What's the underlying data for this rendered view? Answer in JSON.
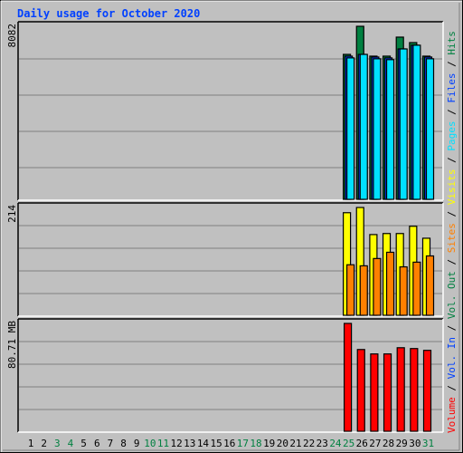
{
  "chart_data": {
    "type": "bar",
    "title": "Daily usage for October 2020",
    "categories": [
      "1",
      "2",
      "3",
      "4",
      "5",
      "6",
      "7",
      "8",
      "9",
      "10",
      "11",
      "12",
      "13",
      "14",
      "15",
      "16",
      "17",
      "18",
      "19",
      "20",
      "21",
      "22",
      "23",
      "24",
      "25",
      "26",
      "27",
      "28",
      "29",
      "30",
      "31"
    ],
    "weekend_days": [
      "3",
      "4",
      "10",
      "11",
      "17",
      "18",
      "24",
      "25",
      "31"
    ],
    "panels": [
      {
        "name": "hits-files-pages",
        "ymax_label": "8082",
        "ylim": [
          0,
          8082
        ],
        "series": [
          {
            "name": "Hits",
            "color": "#008040",
            "values": [
              null,
              null,
              null,
              null,
              null,
              null,
              null,
              null,
              null,
              null,
              null,
              null,
              null,
              null,
              null,
              null,
              null,
              null,
              null,
              null,
              null,
              null,
              null,
              null,
              6630,
              7915,
              6550,
              6550,
              7420,
              7170,
              6550
            ]
          },
          {
            "name": "Files",
            "color": "#0040FF",
            "values": [
              null,
              null,
              null,
              null,
              null,
              null,
              null,
              null,
              null,
              null,
              null,
              null,
              null,
              null,
              null,
              null,
              null,
              null,
              null,
              null,
              null,
              null,
              null,
              null,
              6550,
              6630,
              6510,
              6470,
              6880,
              7050,
              6510
            ]
          },
          {
            "name": "Pages",
            "color": "#00E0FF",
            "values": [
              null,
              null,
              null,
              null,
              null,
              null,
              null,
              null,
              null,
              null,
              null,
              null,
              null,
              null,
              null,
              null,
              null,
              null,
              null,
              null,
              null,
              null,
              null,
              null,
              6470,
              6630,
              6430,
              6390,
              6880,
              7050,
              6430
            ]
          }
        ]
      },
      {
        "name": "visits-sites",
        "ymax_label": "214",
        "ylim": [
          0,
          214
        ],
        "series": [
          {
            "name": "Visits",
            "color": "#FFFF00",
            "values": [
              null,
              null,
              null,
              null,
              null,
              null,
              null,
              null,
              null,
              null,
              null,
              null,
              null,
              null,
              null,
              null,
              null,
              null,
              null,
              null,
              null,
              null,
              null,
              null,
              197,
              207,
              155,
              157,
              157,
              171,
              148
            ]
          },
          {
            "name": "Sites",
            "color": "#FF8000",
            "values": [
              null,
              null,
              null,
              null,
              null,
              null,
              null,
              null,
              null,
              null,
              null,
              null,
              null,
              null,
              null,
              null,
              null,
              null,
              null,
              null,
              null,
              null,
              null,
              null,
              97,
              95,
              109,
              121,
              93,
              102,
              114
            ]
          }
        ]
      },
      {
        "name": "volume",
        "ymax_label": "80.71 MB",
        "ylim": [
          0,
          80.71
        ],
        "series": [
          {
            "name": "Volume",
            "color": "#FF0000",
            "values": [
              null,
              null,
              null,
              null,
              null,
              null,
              null,
              null,
              null,
              null,
              null,
              null,
              null,
              null,
              null,
              null,
              null,
              null,
              null,
              null,
              null,
              null,
              null,
              null,
              78.1,
              59.2,
              56.0,
              56.0,
              60.5,
              59.9,
              58.6
            ]
          }
        ]
      }
    ],
    "legend": {
      "placement": "right-vertical",
      "items": [
        {
          "label": "Volume",
          "color": "#FF0000"
        },
        {
          "label": "Vol. In",
          "color": "#0040FF"
        },
        {
          "label": "Vol. Out",
          "color": "#008040"
        },
        {
          "label": "Sites",
          "color": "#FF8000"
        },
        {
          "label": "Visits",
          "color": "#FFFF00"
        },
        {
          "label": "Pages",
          "color": "#00E0FF"
        },
        {
          "label": "Files",
          "color": "#0040FF"
        },
        {
          "label": "Hits",
          "color": "#008040"
        }
      ],
      "separator": " / "
    },
    "grid": true,
    "colors": {
      "background": "#C0C0C0",
      "title": "#0040FF",
      "gridline": "#808080",
      "weekday_label": "#000000",
      "weekend_label": "#008040"
    }
  }
}
